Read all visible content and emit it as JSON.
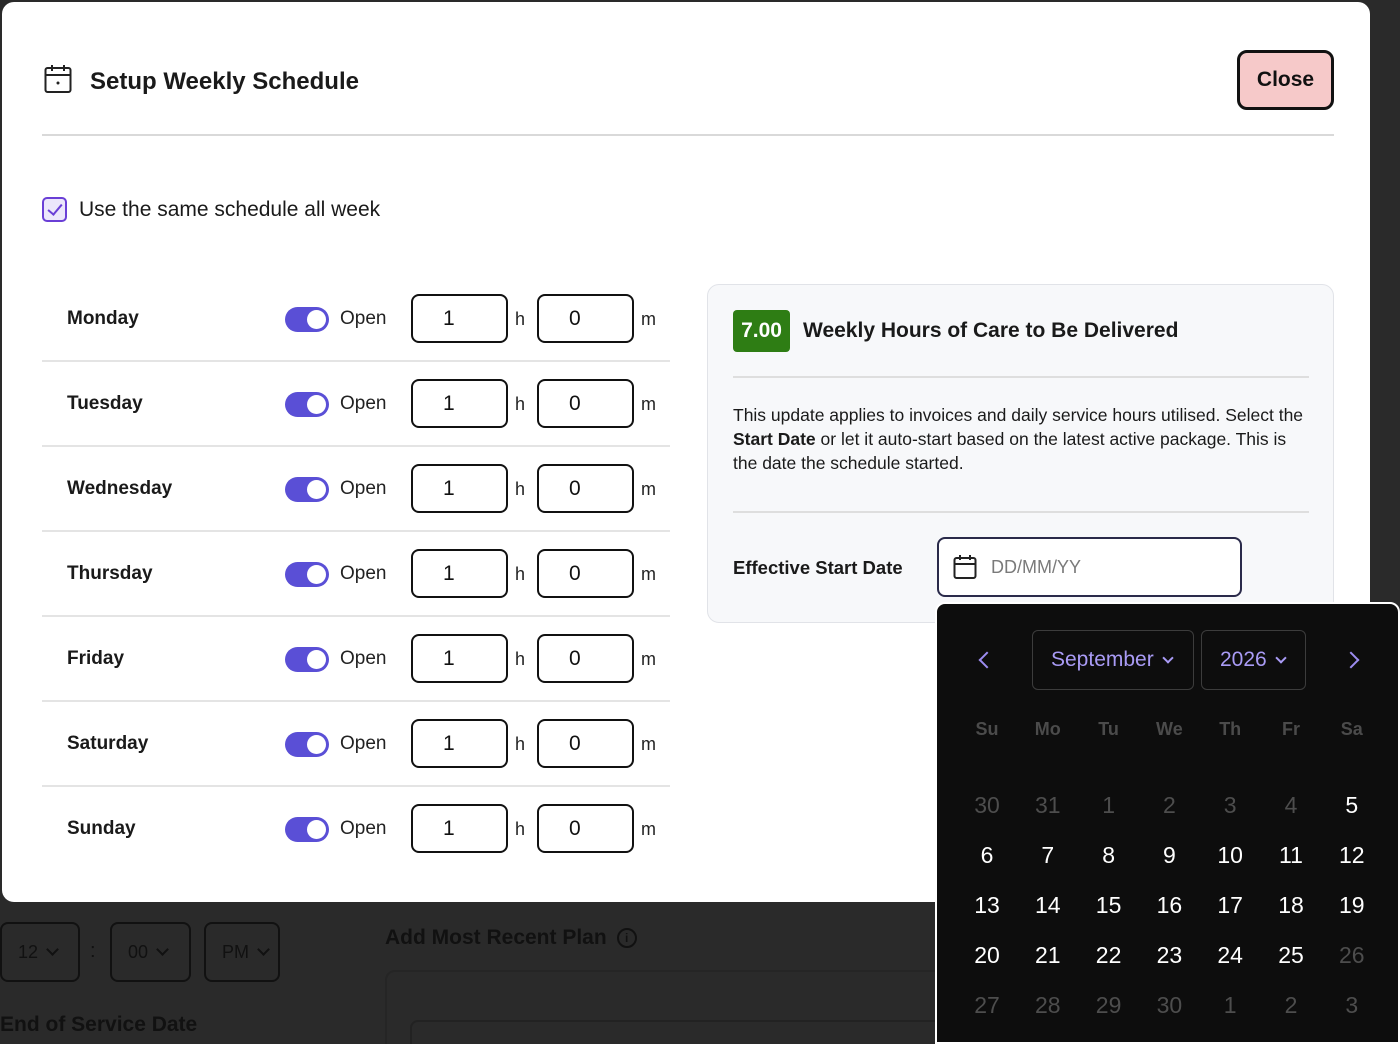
{
  "background": {
    "hour_select": "12",
    "colon": ":",
    "minute_select": "00",
    "ampm_select": "PM",
    "plan_heading": "Add Most Recent Plan",
    "info_icon": "info-icon",
    "end_service_label": "End of Service Date"
  },
  "modal": {
    "title": "Setup Weekly Schedule",
    "title_icon": "calendar-icon",
    "close_label": "Close",
    "same_schedule_label": "Use the same schedule all week",
    "same_schedule_checked": true,
    "toggle_color": "#5a4fd6",
    "days": [
      {
        "name": "Monday",
        "status": "Open",
        "hours": "1",
        "h": "h",
        "minutes": "0",
        "m": "m"
      },
      {
        "name": "Tuesday",
        "status": "Open",
        "hours": "1",
        "h": "h",
        "minutes": "0",
        "m": "m"
      },
      {
        "name": "Wednesday",
        "status": "Open",
        "hours": "1",
        "h": "h",
        "minutes": "0",
        "m": "m"
      },
      {
        "name": "Thursday",
        "status": "Open",
        "hours": "1",
        "h": "h",
        "minutes": "0",
        "m": "m"
      },
      {
        "name": "Friday",
        "status": "Open",
        "hours": "1",
        "h": "h",
        "minutes": "0",
        "m": "m"
      },
      {
        "name": "Saturday",
        "status": "Open",
        "hours": "1",
        "h": "h",
        "minutes": "0",
        "m": "m"
      },
      {
        "name": "Sunday",
        "status": "Open",
        "hours": "1",
        "h": "h",
        "minutes": "0",
        "m": "m"
      }
    ]
  },
  "summary": {
    "hours_value": "7.00",
    "badge_color": "#2e7d14",
    "title": "Weekly Hours of Care to Be Delivered",
    "text_before": "This update applies to invoices and daily service hours utilised. Select the ",
    "text_bold": "Start Date",
    "text_after": " or let it auto-start based on the latest active package. This is the date the schedule started.",
    "start_label": "Effective Start Date",
    "date_placeholder": "DD/MM/YY"
  },
  "datepicker": {
    "month": "September",
    "year": "2026",
    "accent_color": "#a99bf5",
    "weekdays": [
      "Su",
      "Mo",
      "Tu",
      "We",
      "Th",
      "Fr",
      "Sa"
    ],
    "weeks": [
      [
        {
          "d": "30",
          "out": true
        },
        {
          "d": "31",
          "out": true
        },
        {
          "d": "1",
          "out": true
        },
        {
          "d": "2",
          "out": true
        },
        {
          "d": "3",
          "out": true
        },
        {
          "d": "4",
          "out": true
        },
        {
          "d": "5",
          "out": false
        }
      ],
      [
        {
          "d": "6",
          "out": false
        },
        {
          "d": "7",
          "out": false
        },
        {
          "d": "8",
          "out": false
        },
        {
          "d": "9",
          "out": false
        },
        {
          "d": "10",
          "out": false
        },
        {
          "d": "11",
          "out": false
        },
        {
          "d": "12",
          "out": false
        }
      ],
      [
        {
          "d": "13",
          "out": false
        },
        {
          "d": "14",
          "out": false
        },
        {
          "d": "15",
          "out": false
        },
        {
          "d": "16",
          "out": false
        },
        {
          "d": "17",
          "out": false
        },
        {
          "d": "18",
          "out": false
        },
        {
          "d": "19",
          "out": false
        }
      ],
      [
        {
          "d": "20",
          "out": false
        },
        {
          "d": "21",
          "out": false
        },
        {
          "d": "22",
          "out": false
        },
        {
          "d": "23",
          "out": false
        },
        {
          "d": "24",
          "out": false
        },
        {
          "d": "25",
          "out": false
        },
        {
          "d": "26",
          "out": true
        }
      ],
      [
        {
          "d": "27",
          "out": true
        },
        {
          "d": "28",
          "out": true
        },
        {
          "d": "29",
          "out": true
        },
        {
          "d": "30",
          "out": true
        },
        {
          "d": "1",
          "out": true
        },
        {
          "d": "2",
          "out": true
        },
        {
          "d": "3",
          "out": true
        }
      ]
    ]
  }
}
